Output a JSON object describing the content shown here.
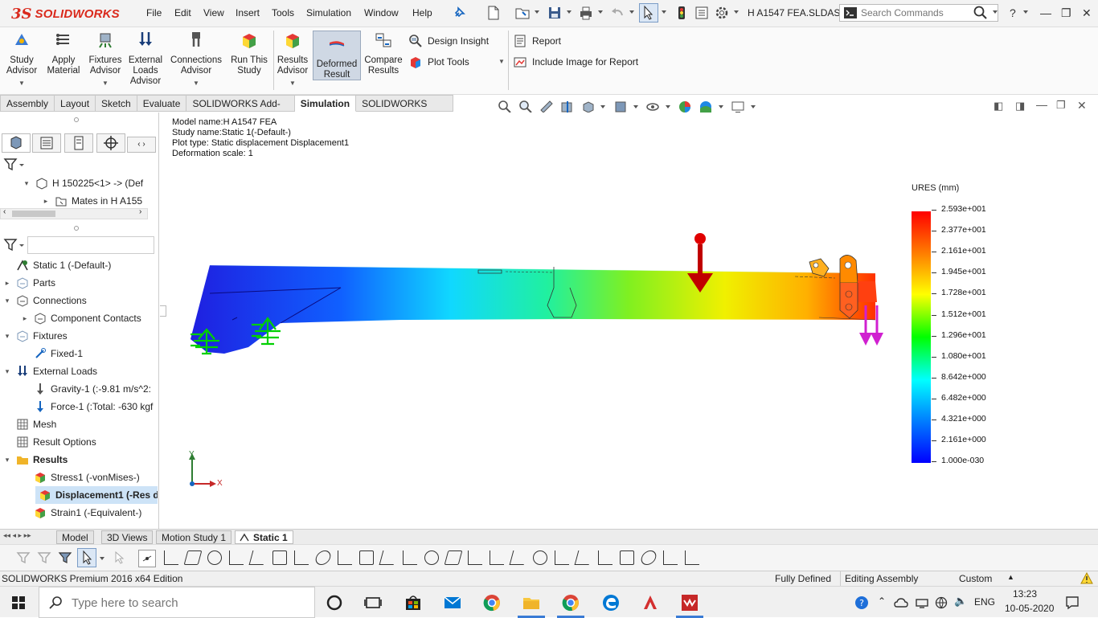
{
  "titlebar": {
    "logo_ds": "3S",
    "logo_text": "SOLIDWORKS",
    "menus": [
      "File",
      "Edit",
      "View",
      "Insert",
      "Tools",
      "Simulation",
      "Window",
      "Help"
    ],
    "document_title": "H A1547 FEA.SLDAS...",
    "search_placeholder": "Search Commands",
    "help_label": "?"
  },
  "ribbon": {
    "buttons": [
      {
        "label": "Study\nAdvisor",
        "icon": "study-advisor-icon"
      },
      {
        "label": "Apply\nMaterial",
        "icon": "apply-material-icon"
      },
      {
        "label": "Fixtures\nAdvisor",
        "icon": "fixtures-advisor-icon"
      },
      {
        "label": "External\nLoads\nAdvisor",
        "icon": "external-loads-icon"
      },
      {
        "label": "Connections\nAdvisor",
        "icon": "connections-advisor-icon"
      },
      {
        "label": "Run This\nStudy",
        "icon": "run-study-icon"
      },
      {
        "label": "Results\nAdvisor",
        "icon": "results-advisor-icon"
      },
      {
        "label": "Deformed\nResult",
        "icon": "deformed-result-icon"
      },
      {
        "label": "Compare\nResults",
        "icon": "compare-results-icon"
      }
    ],
    "design_insight": "Design Insight",
    "plot_tools": "Plot Tools",
    "report": "Report",
    "include_image": "Include Image for Report"
  },
  "command_tabs": [
    {
      "label": "Assembly",
      "active": false
    },
    {
      "label": "Layout",
      "active": false
    },
    {
      "label": "Sketch",
      "active": false
    },
    {
      "label": "Evaluate",
      "active": false
    },
    {
      "label": "SOLIDWORKS Add-Ins",
      "active": false
    },
    {
      "label": "Simulation",
      "active": true
    },
    {
      "label": "SOLIDWORKS MBD",
      "active": false
    }
  ],
  "featuretree": {
    "top_items": [
      {
        "label": "H 150225<1> -> (Def",
        "expand": "▾"
      },
      {
        "label": "Mates in H A155",
        "expand": "▸"
      }
    ],
    "study_items": [
      {
        "label": "Static 1 (-Default-)",
        "indent": 0,
        "expand": "",
        "icon": "study-icon",
        "selected": false
      },
      {
        "label": "Parts",
        "indent": 1,
        "expand": "▸",
        "icon": "parts-icon",
        "selected": false
      },
      {
        "label": "Connections",
        "indent": 1,
        "expand": "▾",
        "icon": "connections-icon",
        "selected": false
      },
      {
        "label": "Component Contacts",
        "indent": 2,
        "expand": "▸",
        "icon": "contacts-icon",
        "selected": false
      },
      {
        "label": "Fixtures",
        "indent": 1,
        "expand": "▾",
        "icon": "fixtures-icon",
        "selected": false
      },
      {
        "label": "Fixed-1",
        "indent": 2,
        "expand": "",
        "icon": "fixed-icon",
        "selected": false
      },
      {
        "label": "External Loads",
        "indent": 1,
        "expand": "▾",
        "icon": "external-loads-icon",
        "selected": false
      },
      {
        "label": "Gravity-1 (:-9.81 m/s^2:",
        "indent": 2,
        "expand": "",
        "icon": "gravity-icon",
        "selected": false
      },
      {
        "label": "Force-1 (:Total: -630 kgf",
        "indent": 2,
        "expand": "",
        "icon": "force-icon",
        "selected": false
      },
      {
        "label": "Mesh",
        "indent": 1,
        "expand": "",
        "icon": "mesh-icon",
        "selected": false
      },
      {
        "label": "Result Options",
        "indent": 1,
        "expand": "",
        "icon": "result-options-icon",
        "selected": false
      },
      {
        "label": "Results",
        "indent": 1,
        "expand": "▾",
        "icon": "results-folder-icon",
        "selected": false,
        "bold": true
      },
      {
        "label": "Stress1 (-vonMises-)",
        "indent": 2,
        "expand": "",
        "icon": "stress-plot-icon",
        "selected": false
      },
      {
        "label": "Displacement1 (-Res d",
        "indent": 2,
        "expand": "",
        "icon": "displacement-plot-icon",
        "selected": true
      },
      {
        "label": "Strain1 (-Equivalent-)",
        "indent": 2,
        "expand": "",
        "icon": "strain-plot-icon",
        "selected": false
      }
    ]
  },
  "plot_info": {
    "model_name": "Model name:H A1547 FEA",
    "study_name": "Study name:Static 1(-Default-)",
    "plot_type": "Plot type: Static displacement Displacement1",
    "deformation_scale": "Deformation scale: 1"
  },
  "legend": {
    "title": "URES (mm)",
    "values": [
      "2.593e+001",
      "2.377e+001",
      "2.161e+001",
      "1.945e+001",
      "1.728e+001",
      "1.512e+001",
      "1.296e+001",
      "1.080e+001",
      "8.642e+000",
      "6.482e+000",
      "4.321e+000",
      "2.161e+000",
      "1.000e-030"
    ]
  },
  "triad": {
    "y": "Y",
    "x": "X"
  },
  "bottom_tabs": [
    {
      "label": "Model",
      "active": false
    },
    {
      "label": "3D Views",
      "active": false
    },
    {
      "label": "Motion Study 1",
      "active": false
    },
    {
      "label": "Static 1",
      "active": true
    }
  ],
  "statusbar": {
    "edition": "SOLIDWORKS Premium 2016 x64 Edition",
    "definition": "Fully Defined",
    "mode": "Editing Assembly",
    "units": "Custom"
  },
  "taskbar": {
    "search_placeholder": "Type here to search",
    "language": "ENG",
    "time": "13:23",
    "date": "10-05-2020"
  },
  "colors": {
    "brand_red": "#da291c",
    "selection": "#cde3f7",
    "ribbon_active": "#cfd8e4"
  }
}
